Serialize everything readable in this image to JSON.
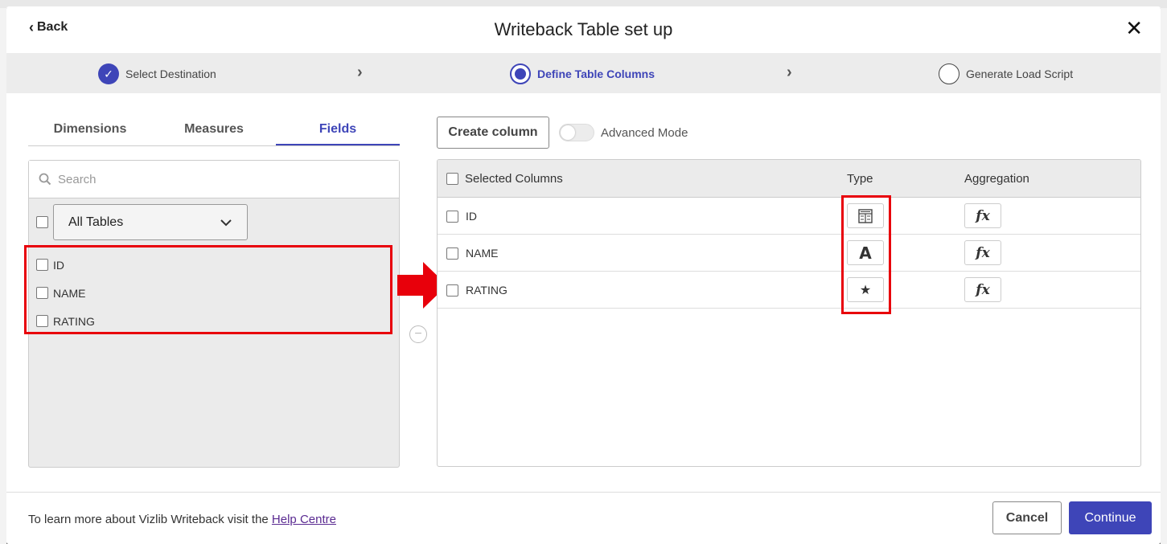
{
  "header": {
    "back_label": "Back",
    "title": "Writeback Table set up",
    "close_label": "✕"
  },
  "stepper": {
    "steps": [
      {
        "label": "Select Destination",
        "state": "completed"
      },
      {
        "label": "Define Table Columns",
        "state": "active"
      },
      {
        "label": "Generate Load Script",
        "state": "pending"
      }
    ]
  },
  "left": {
    "tabs": [
      {
        "label": "Dimensions",
        "active": false
      },
      {
        "label": "Measures",
        "active": false
      },
      {
        "label": "Fields",
        "active": true
      }
    ],
    "search_placeholder": "Search",
    "table_select": "All Tables",
    "fields": [
      "ID",
      "NAME",
      "RATING"
    ]
  },
  "right": {
    "create_column_label": "Create column",
    "advanced_mode_label": "Advanced Mode",
    "columns_header": {
      "selected": "Selected Columns",
      "type": "Type",
      "aggregation": "Aggregation"
    },
    "columns": [
      {
        "name": "ID",
        "type_icon": "number-grid-icon"
      },
      {
        "name": "NAME",
        "type_icon": "text-a-icon"
      },
      {
        "name": "RATING",
        "type_icon": "star-icon"
      }
    ],
    "aggregation_icon_label": "fx"
  },
  "footer": {
    "text_prefix": "To learn more about Vizlib Writeback visit the ",
    "link_label": "Help Centre",
    "cancel_label": "Cancel",
    "continue_label": "Continue"
  },
  "colors": {
    "accent": "#3e45b8",
    "annotation_red": "#e8000b"
  }
}
